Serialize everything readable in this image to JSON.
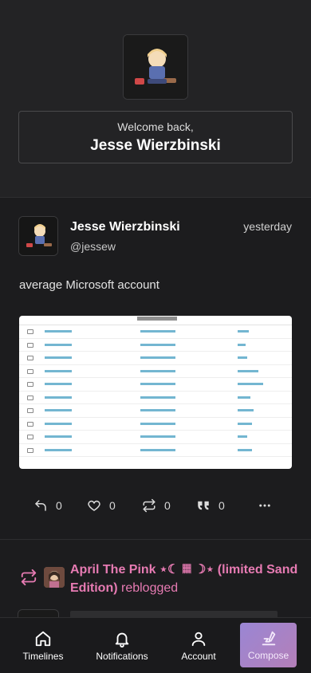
{
  "profile": {
    "welcome_text": "Welcome back,",
    "display_name": "Jesse Wierzbinski"
  },
  "post": {
    "author_name": "Jesse Wierzbinski",
    "author_handle": "@jessew",
    "timestamp": "yesterday",
    "body": "average Microsoft account",
    "actions": {
      "reply_count": "0",
      "like_count": "0",
      "reblog_count": "0",
      "quote_count": "0"
    }
  },
  "reblog_notice": {
    "name": "April The Pink ⋆☾ 𝄜 ☽⋆ (limited Sand Edition)",
    "suffix": " reblogged"
  },
  "nav": {
    "timelines": "Timelines",
    "notifications": "Notifications",
    "account": "Account",
    "compose": "Compose"
  },
  "colors": {
    "accent_pink": "#e77bb3",
    "compose_gradient_start": "#9a86d4",
    "compose_gradient_end": "#b47fb8",
    "background": "#1c1c1e"
  },
  "icons": {
    "reply": "reply-icon",
    "like": "heart-icon",
    "reblog": "repeat-icon",
    "quote": "quote-icon",
    "more": "more-horizontal-icon",
    "timelines": "home-icon",
    "notifications": "bell-icon",
    "account": "user-icon",
    "compose": "compose-icon"
  }
}
